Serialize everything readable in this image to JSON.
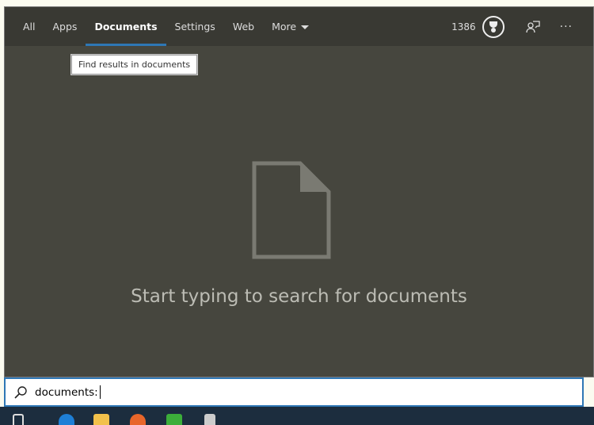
{
  "tabs": [
    {
      "label": "All"
    },
    {
      "label": "Apps"
    },
    {
      "label": "Documents",
      "active": true
    },
    {
      "label": "Settings"
    },
    {
      "label": "Web"
    },
    {
      "label": "More"
    }
  ],
  "header": {
    "points": "1386",
    "icons": [
      "trophy-icon",
      "feedback-icon",
      "more-options-icon"
    ],
    "more_dots": "···"
  },
  "tooltip": "Find results in documents",
  "empty_state": {
    "icon": "document-icon",
    "message": "Start typing to search for documents"
  },
  "search": {
    "value": "documents:",
    "icon": "search-icon"
  },
  "taskbar": {
    "items": [
      "task-view",
      "edge",
      "file-explorer",
      "firefox",
      "app-green",
      "app-stamp"
    ]
  },
  "colors": {
    "accent": "#2e77b5",
    "panel": "#46463e",
    "header": "#393933",
    "taskbar": "#1c2d3e"
  }
}
